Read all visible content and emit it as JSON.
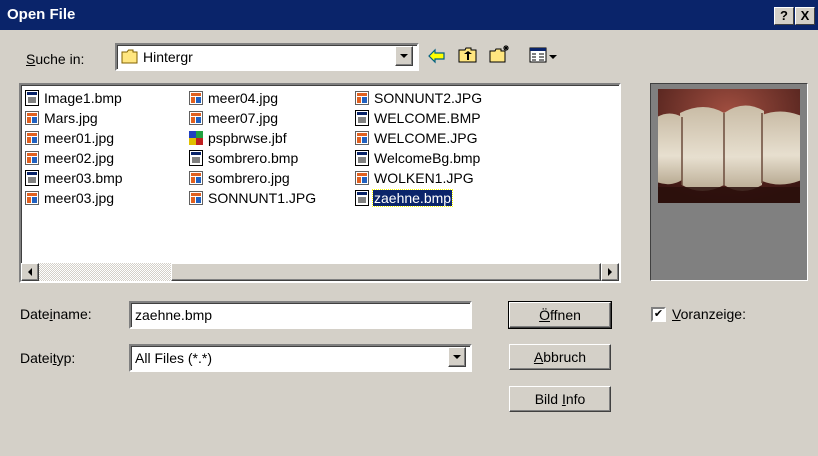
{
  "window": {
    "title": "Open File",
    "help_button": "?",
    "close_button": "X"
  },
  "lookin": {
    "label_pre": "",
    "label_u": "S",
    "label_post": "uche in:",
    "folder": "Hintergr"
  },
  "files": [
    {
      "name": "Image1.bmp",
      "type": "bmp"
    },
    {
      "name": "Mars.jpg",
      "type": "jpg"
    },
    {
      "name": "meer01.jpg",
      "type": "jpg"
    },
    {
      "name": "meer02.jpg",
      "type": "jpg"
    },
    {
      "name": "meer03.bmp",
      "type": "bmp"
    },
    {
      "name": "meer03.jpg",
      "type": "jpg"
    },
    {
      "name": "meer04.jpg",
      "type": "jpg"
    },
    {
      "name": "meer07.jpg",
      "type": "jpg"
    },
    {
      "name": "pspbrwse.jbf",
      "type": "jbf"
    },
    {
      "name": "sombrero.bmp",
      "type": "bmp"
    },
    {
      "name": "sombrero.jpg",
      "type": "jpg"
    },
    {
      "name": "SONNUNT1.JPG",
      "type": "jpg"
    },
    {
      "name": "SONNUNT2.JPG",
      "type": "jpg"
    },
    {
      "name": "WELCOME.BMP",
      "type": "bmp"
    },
    {
      "name": "WELCOME.JPG",
      "type": "jpg"
    },
    {
      "name": "WelcomeBg.bmp",
      "type": "bmp"
    },
    {
      "name": "WOLKEN1.JPG",
      "type": "jpg"
    },
    {
      "name": "zaehne.bmp",
      "type": "bmp",
      "selected": true
    }
  ],
  "filename": {
    "label_pre": "Date",
    "label_u": "i",
    "label_post": "name:",
    "value": "zaehne.bmp"
  },
  "filetype": {
    "label_pre": "Datei",
    "label_u": "t",
    "label_post": "yp:",
    "value": "All Files (*.*)"
  },
  "buttons": {
    "open": {
      "pre": "",
      "u": "Ö",
      "post": "ffnen"
    },
    "cancel": {
      "pre": "",
      "u": "A",
      "post": "bbruch"
    },
    "info": {
      "pre": "Bild ",
      "u": "I",
      "post": "nfo"
    }
  },
  "preview": {
    "check_mark": "✔",
    "label_pre": "",
    "label_u": "V",
    "label_post": "oranzeige:"
  },
  "colors": {
    "face": "#d4d0c8",
    "title": "#0a246a",
    "preview_bg": "#808080",
    "selection": "#0a246a"
  }
}
